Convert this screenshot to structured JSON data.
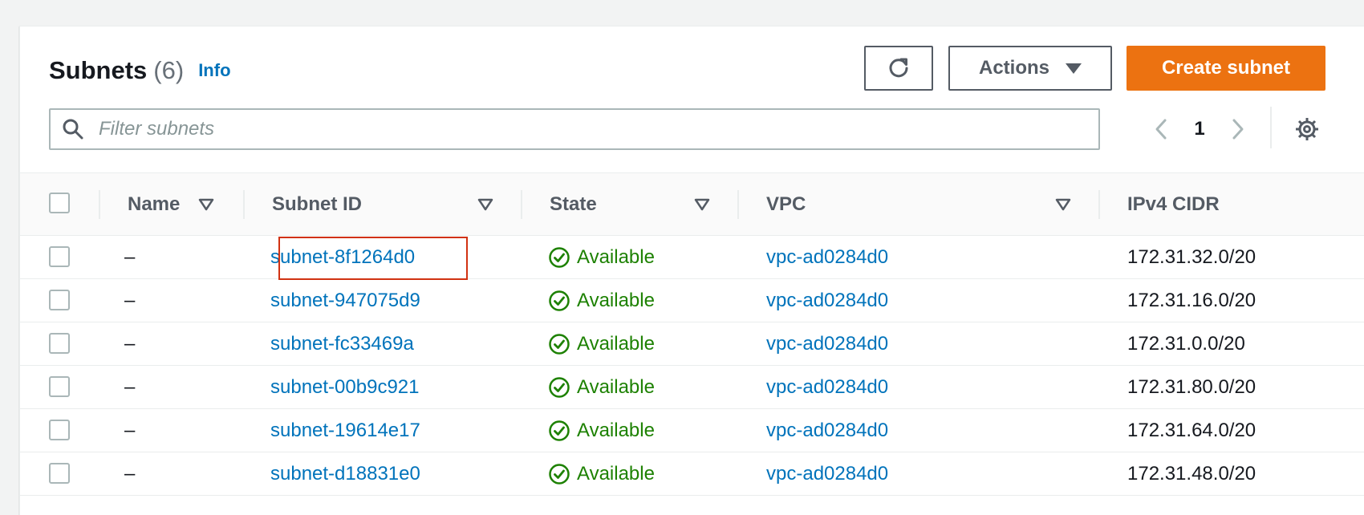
{
  "header": {
    "title": "Subnets",
    "count": "(6)",
    "info_label": "Info",
    "actions_label": "Actions",
    "create_label": "Create subnet"
  },
  "filter": {
    "placeholder": "Filter subnets",
    "value": ""
  },
  "pagination": {
    "current_page": "1"
  },
  "table": {
    "columns": [
      "Name",
      "Subnet ID",
      "State",
      "VPC",
      "IPv4 CIDR"
    ],
    "rows": [
      {
        "name": "–",
        "subnet_id": "subnet-8f1264d0",
        "state": "Available",
        "vpc": "vpc-ad0284d0",
        "cidr": "172.31.32.0/20"
      },
      {
        "name": "–",
        "subnet_id": "subnet-947075d9",
        "state": "Available",
        "vpc": "vpc-ad0284d0",
        "cidr": "172.31.16.0/20"
      },
      {
        "name": "–",
        "subnet_id": "subnet-fc33469a",
        "state": "Available",
        "vpc": "vpc-ad0284d0",
        "cidr": "172.31.0.0/20"
      },
      {
        "name": "–",
        "subnet_id": "subnet-00b9c921",
        "state": "Available",
        "vpc": "vpc-ad0284d0",
        "cidr": "172.31.80.0/20"
      },
      {
        "name": "–",
        "subnet_id": "subnet-19614e17",
        "state": "Available",
        "vpc": "vpc-ad0284d0",
        "cidr": "172.31.64.0/20"
      },
      {
        "name": "–",
        "subnet_id": "subnet-d18831e0",
        "state": "Available",
        "vpc": "vpc-ad0284d0",
        "cidr": "172.31.48.0/20"
      }
    ]
  },
  "colors": {
    "primary_button": "#ec7211",
    "link": "#0073bb",
    "success": "#1d8102",
    "highlight": "#d13212"
  },
  "icons": {
    "refresh": "refresh-icon",
    "caret": "caret-down-icon",
    "search": "search-icon",
    "prev": "chevron-left-icon",
    "next": "chevron-right-icon",
    "settings": "gear-icon",
    "sort": "sort-caret-icon",
    "status": "check-circle-icon"
  }
}
